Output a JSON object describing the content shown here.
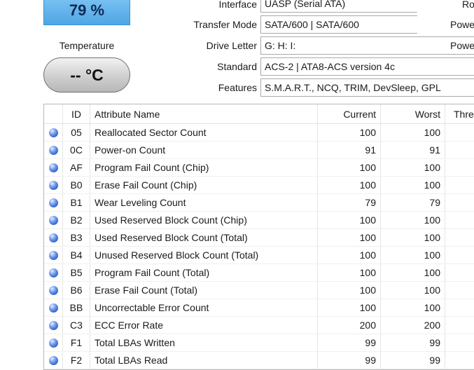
{
  "health": {
    "percent": "79 %"
  },
  "temperature": {
    "label": "Temperature",
    "value": "-- °C"
  },
  "info": {
    "interface": {
      "label": "Interface",
      "value": "UASP (Serial ATA)"
    },
    "transfer_mode": {
      "label": "Transfer Mode",
      "value": "SATA/600 | SATA/600"
    },
    "drive_letter": {
      "label": "Drive Letter",
      "value": "G: H: I:"
    },
    "standard": {
      "label": "Standard",
      "value": "ACS-2 | ATA8-ACS version 4c"
    },
    "features": {
      "label": "Features",
      "value": "S.M.A.R.T., NCQ, TRIM, DevSleep, GPL"
    }
  },
  "right_labels": [
    "Ro",
    "Powe",
    "Powe"
  ],
  "table": {
    "headers": {
      "id": "ID",
      "name": "Attribute Name",
      "current": "Current",
      "worst": "Worst",
      "threshold": "Thre"
    },
    "rows": [
      {
        "id": "05",
        "name": "Reallocated Sector Count",
        "current": "100",
        "worst": "100"
      },
      {
        "id": "0C",
        "name": "Power-on Count",
        "current": "91",
        "worst": "91"
      },
      {
        "id": "AF",
        "name": "Program Fail Count (Chip)",
        "current": "100",
        "worst": "100"
      },
      {
        "id": "B0",
        "name": "Erase Fail Count (Chip)",
        "current": "100",
        "worst": "100"
      },
      {
        "id": "B1",
        "name": "Wear Leveling Count",
        "current": "79",
        "worst": "79"
      },
      {
        "id": "B2",
        "name": "Used Reserved Block Count (Chip)",
        "current": "100",
        "worst": "100"
      },
      {
        "id": "B3",
        "name": "Used Reserved Block Count (Total)",
        "current": "100",
        "worst": "100"
      },
      {
        "id": "B4",
        "name": "Unused Reserved Block Count (Total)",
        "current": "100",
        "worst": "100"
      },
      {
        "id": "B5",
        "name": "Program Fail Count (Total)",
        "current": "100",
        "worst": "100"
      },
      {
        "id": "B6",
        "name": "Erase Fail Count (Total)",
        "current": "100",
        "worst": "100"
      },
      {
        "id": "BB",
        "name": "Uncorrectable Error Count",
        "current": "100",
        "worst": "100"
      },
      {
        "id": "C3",
        "name": "ECC Error Rate",
        "current": "200",
        "worst": "200"
      },
      {
        "id": "F1",
        "name": "Total LBAs Written",
        "current": "99",
        "worst": "99"
      },
      {
        "id": "F2",
        "name": "Total LBAs Read",
        "current": "99",
        "worst": "99"
      }
    ]
  }
}
